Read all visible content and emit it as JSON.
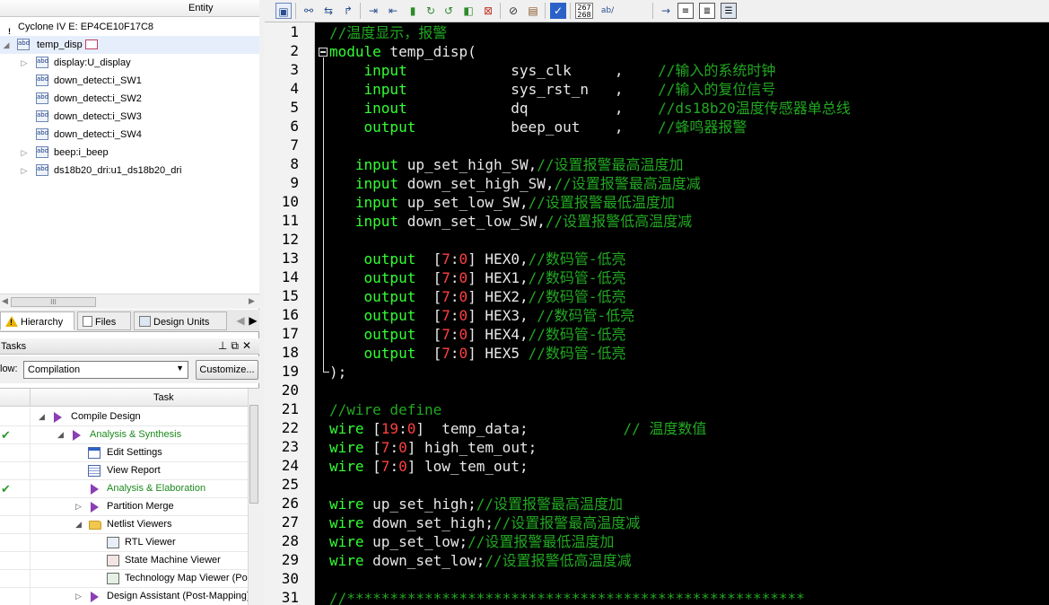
{
  "project_navigator": {
    "column_header": "Entity",
    "device": "Cyclone IV E: EP4CE10F17C8",
    "top_entity": "temp_disp",
    "children": [
      "display:U_display",
      "down_detect:i_SW1",
      "down_detect:i_SW2",
      "down_detect:i_SW3",
      "down_detect:i_SW4",
      "beep:i_beep",
      "ds18b20_dri:u1_ds18b20_dri"
    ],
    "scroll_glyph": "III",
    "tabs": [
      "Hierarchy",
      "Files",
      "Design Units"
    ]
  },
  "tasks": {
    "title": "Tasks",
    "flow_label": "low:",
    "flow_value": "Compilation",
    "customize_button": "Customize...",
    "task_column": "Task",
    "items": [
      {
        "label": "Compile Design",
        "done": false,
        "green": false
      },
      {
        "label": "Analysis & Synthesis",
        "done": true,
        "green": true
      },
      {
        "label": "Edit Settings",
        "done": false,
        "green": false
      },
      {
        "label": "View Report",
        "done": false,
        "green": false
      },
      {
        "label": "Analysis & Elaboration",
        "done": true,
        "green": true
      },
      {
        "label": "Partition Merge",
        "done": false,
        "green": false
      },
      {
        "label": "Netlist Viewers",
        "done": false,
        "green": false
      },
      {
        "label": "RTL Viewer",
        "done": false,
        "green": false
      },
      {
        "label": "State Machine Viewer",
        "done": false,
        "green": false
      },
      {
        "label": "Technology Map Viewer (Pos",
        "done": false,
        "green": false
      },
      {
        "label": "Design Assistant (Post-Mapping)",
        "done": false,
        "green": false
      }
    ],
    "check_glyph": "✔"
  },
  "toolbar": {
    "number_box_top": "267",
    "number_box_bottom": "268",
    "ab_label": "ab/"
  },
  "editor": {
    "line_numbers": [
      "1",
      "2",
      "3",
      "4",
      "5",
      "6",
      "7",
      "8",
      "9",
      "10",
      "11",
      "12",
      "13",
      "14",
      "15",
      "16",
      "17",
      "18",
      "19",
      "20",
      "21",
      "22",
      "23",
      "24",
      "25",
      "26",
      "27",
      "28",
      "29",
      "30",
      "31"
    ],
    "lines": [
      [
        [
          "cm",
          "//温度显示，报警"
        ]
      ],
      [
        [
          "kw",
          "module"
        ],
        [
          "id",
          " temp_disp("
        ]
      ],
      [
        [
          "id",
          "    "
        ],
        [
          "kw",
          "input"
        ],
        [
          "id",
          "            sys_clk     ,    "
        ],
        [
          "cm",
          "//输入的系统时钟"
        ]
      ],
      [
        [
          "id",
          "    "
        ],
        [
          "kw",
          "input"
        ],
        [
          "id",
          "            sys_rst_n   ,    "
        ],
        [
          "cm",
          "//输入的复位信号"
        ]
      ],
      [
        [
          "id",
          "    "
        ],
        [
          "kw",
          "inout"
        ],
        [
          "id",
          "            dq          ,    "
        ],
        [
          "cm",
          "//ds18b20温度传感器单总线"
        ]
      ],
      [
        [
          "id",
          "    "
        ],
        [
          "kw",
          "output"
        ],
        [
          "id",
          "           beep_out    ,    "
        ],
        [
          "cm",
          "//蜂鸣器报警"
        ]
      ],
      [],
      [
        [
          "id",
          "   "
        ],
        [
          "kw",
          "input"
        ],
        [
          "id",
          " up_set_high_SW,"
        ],
        [
          "cm",
          "//设置报警最高温度加"
        ]
      ],
      [
        [
          "id",
          "   "
        ],
        [
          "kw",
          "input"
        ],
        [
          "id",
          " down_set_high_SW,"
        ],
        [
          "cm",
          "//设置报警最高温度减"
        ]
      ],
      [
        [
          "id",
          "   "
        ],
        [
          "kw",
          "input"
        ],
        [
          "id",
          " up_set_low_SW,"
        ],
        [
          "cm",
          "//设置报警最低温度加"
        ]
      ],
      [
        [
          "id",
          "   "
        ],
        [
          "kw",
          "input"
        ],
        [
          "id",
          " down_set_low_SW,"
        ],
        [
          "cm",
          "//设置报警低高温度减"
        ]
      ],
      [],
      [
        [
          "id",
          "    "
        ],
        [
          "kw",
          "output"
        ],
        [
          "id",
          "  ["
        ],
        [
          "num",
          "7"
        ],
        [
          "id",
          ":"
        ],
        [
          "num",
          "0"
        ],
        [
          "id",
          "] HEX0,"
        ],
        [
          "cm",
          "//数码管-低亮"
        ]
      ],
      [
        [
          "id",
          "    "
        ],
        [
          "kw",
          "output"
        ],
        [
          "id",
          "  ["
        ],
        [
          "num",
          "7"
        ],
        [
          "id",
          ":"
        ],
        [
          "num",
          "0"
        ],
        [
          "id",
          "] HEX1,"
        ],
        [
          "cm",
          "//数码管-低亮"
        ]
      ],
      [
        [
          "id",
          "    "
        ],
        [
          "kw",
          "output"
        ],
        [
          "id",
          "  ["
        ],
        [
          "num",
          "7"
        ],
        [
          "id",
          ":"
        ],
        [
          "num",
          "0"
        ],
        [
          "id",
          "] HEX2,"
        ],
        [
          "cm",
          "//数码管-低亮"
        ]
      ],
      [
        [
          "id",
          "    "
        ],
        [
          "kw",
          "output"
        ],
        [
          "id",
          "  ["
        ],
        [
          "num",
          "7"
        ],
        [
          "id",
          ":"
        ],
        [
          "num",
          "0"
        ],
        [
          "id",
          "] HEX3, "
        ],
        [
          "cm",
          "//数码管-低亮"
        ]
      ],
      [
        [
          "id",
          "    "
        ],
        [
          "kw",
          "output"
        ],
        [
          "id",
          "  ["
        ],
        [
          "num",
          "7"
        ],
        [
          "id",
          ":"
        ],
        [
          "num",
          "0"
        ],
        [
          "id",
          "] HEX4,"
        ],
        [
          "cm",
          "//数码管-低亮"
        ]
      ],
      [
        [
          "id",
          "    "
        ],
        [
          "kw",
          "output"
        ],
        [
          "id",
          "  ["
        ],
        [
          "num",
          "7"
        ],
        [
          "id",
          ":"
        ],
        [
          "num",
          "0"
        ],
        [
          "id",
          "] HEX5 "
        ],
        [
          "cm",
          "//数码管-低亮"
        ]
      ],
      [
        [
          "id",
          ");"
        ]
      ],
      [],
      [
        [
          "cm",
          "//wire define"
        ]
      ],
      [
        [
          "kw",
          "wire"
        ],
        [
          "id",
          " ["
        ],
        [
          "num",
          "19"
        ],
        [
          "id",
          ":"
        ],
        [
          "num",
          "0"
        ],
        [
          "id",
          "]  temp_data;           "
        ],
        [
          "cm",
          "// 温度数值"
        ]
      ],
      [
        [
          "kw",
          "wire"
        ],
        [
          "id",
          " ["
        ],
        [
          "num",
          "7"
        ],
        [
          "id",
          ":"
        ],
        [
          "num",
          "0"
        ],
        [
          "id",
          "] high_tem_out;"
        ]
      ],
      [
        [
          "kw",
          "wire"
        ],
        [
          "id",
          " ["
        ],
        [
          "num",
          "7"
        ],
        [
          "id",
          ":"
        ],
        [
          "num",
          "0"
        ],
        [
          "id",
          "] low_tem_out;"
        ]
      ],
      [],
      [
        [
          "kw",
          "wire"
        ],
        [
          "id",
          " up_set_high;"
        ],
        [
          "cm",
          "//设置报警最高温度加"
        ]
      ],
      [
        [
          "kw",
          "wire"
        ],
        [
          "id",
          " down_set_high;"
        ],
        [
          "cm",
          "//设置报警最高温度减"
        ]
      ],
      [
        [
          "kw",
          "wire"
        ],
        [
          "id",
          " up_set_low;"
        ],
        [
          "cm",
          "//设置报警最低温度加"
        ]
      ],
      [
        [
          "kw",
          "wire"
        ],
        [
          "id",
          " down_set_low;"
        ],
        [
          "cm",
          "//设置报警低高温度减"
        ]
      ],
      [],
      [
        [
          "cm",
          "//*****************************************************"
        ]
      ]
    ]
  },
  "colors": {
    "keyword": "#33ff33",
    "comment": "#22a822",
    "number": "#ff4040",
    "identifier": "#e8e8e8",
    "editor_bg": "#000000"
  }
}
